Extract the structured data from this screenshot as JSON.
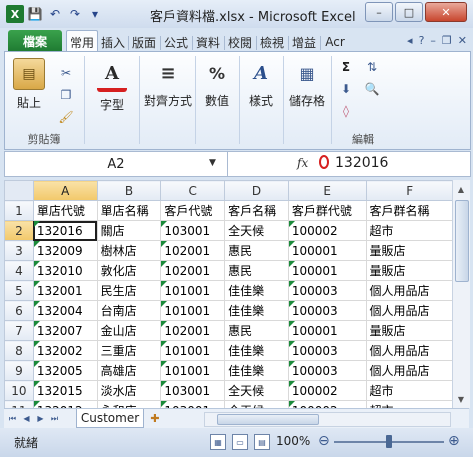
{
  "window": {
    "title": "客戶資料檔.xlsx - Microsoft Excel",
    "controls": {
      "minimize": "–",
      "maximize": "□",
      "close": "✕"
    }
  },
  "qat": {
    "save": "💾",
    "undo": "↶",
    "redo": "↷",
    "customize": "▾"
  },
  "ribbon": {
    "file_tab": "檔案",
    "tabs": [
      "常用",
      "插入",
      "版面",
      "公式",
      "資料",
      "校閱",
      "檢視",
      "增益",
      "Acr"
    ],
    "active_tab": "常用",
    "groups": {
      "clipboard": {
        "label": "剪貼簿",
        "paste": "貼上"
      },
      "font": {
        "label": "字型"
      },
      "alignment": {
        "label": "對齊方式"
      },
      "number": {
        "label": "數值"
      },
      "styles": {
        "label": "樣式"
      },
      "cells": {
        "label": "儲存格"
      },
      "editing": {
        "label": "編輯"
      }
    }
  },
  "formula_bar": {
    "name_box": "A2",
    "fx": "fx",
    "value": "132016"
  },
  "sheet": {
    "columns": [
      "A",
      "B",
      "C",
      "D",
      "E",
      "F"
    ],
    "selected_col": "A",
    "selected_row": 2,
    "rows": [
      [
        "單店代號",
        "單店名稱",
        "客戶代號",
        "客戶名稱",
        "客戶群代號",
        "客戶群名稱"
      ],
      [
        "132016",
        "關店",
        "103001",
        "全天候",
        "100002",
        "超市"
      ],
      [
        "132009",
        "樹林店",
        "102001",
        "惠民",
        "100001",
        "量販店"
      ],
      [
        "132010",
        "敦化店",
        "102001",
        "惠民",
        "100001",
        "量販店"
      ],
      [
        "132001",
        "民生店",
        "101001",
        "佳佳樂",
        "100003",
        "個人用品店"
      ],
      [
        "132004",
        "台南店",
        "101001",
        "佳佳樂",
        "100003",
        "個人用品店"
      ],
      [
        "132007",
        "金山店",
        "102001",
        "惠民",
        "100001",
        "量販店"
      ],
      [
        "132002",
        "三重店",
        "101001",
        "佳佳樂",
        "100003",
        "個人用品店"
      ],
      [
        "132005",
        "高雄店",
        "101001",
        "佳佳樂",
        "100003",
        "個人用品店"
      ],
      [
        "132015",
        "淡水店",
        "103001",
        "全天候",
        "100002",
        "超市"
      ],
      [
        "132012",
        "永和店",
        "103001",
        "全天候",
        "100002",
        "超市"
      ]
    ],
    "tab_name": "Customer"
  },
  "status": {
    "ready": "就緒",
    "zoom": "100%"
  }
}
